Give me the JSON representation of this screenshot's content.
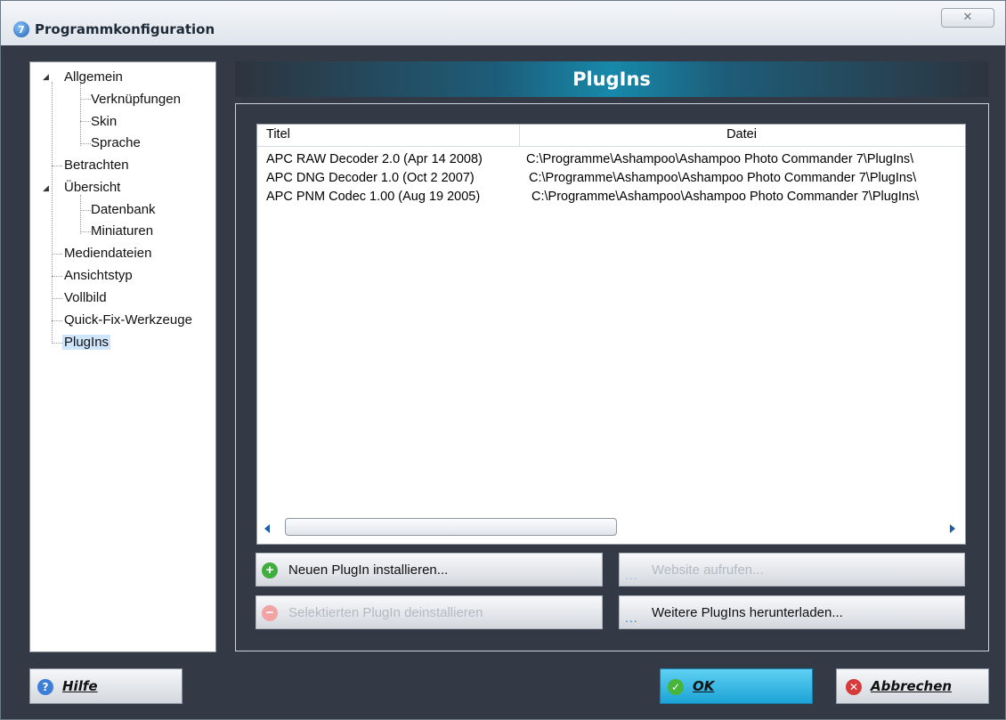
{
  "window": {
    "title": "Programmkonfiguration",
    "app_icon_glyph": "7",
    "close_glyph": "✕"
  },
  "tree": {
    "items": [
      {
        "label": "Allgemein",
        "expanded": true
      },
      {
        "label": "Verknüpfungen"
      },
      {
        "label": "Skin"
      },
      {
        "label": "Sprache"
      },
      {
        "label": "Betrachten"
      },
      {
        "label": "Übersicht",
        "expanded": true
      },
      {
        "label": "Datenbank"
      },
      {
        "label": "Miniaturen"
      },
      {
        "label": "Mediendateien"
      },
      {
        "label": "Ansichtstyp"
      },
      {
        "label": "Vollbild"
      },
      {
        "label": "Quick-Fix-Werkzeuge"
      },
      {
        "label": "PlugIns",
        "selected": true
      }
    ]
  },
  "main": {
    "header": "PlugIns",
    "list": {
      "columns": [
        "Titel",
        "Datei"
      ],
      "rows": [
        [
          "APC RAW Decoder 2.0 (Apr 14 2008)",
          "C:\\Programme\\Ashampoo\\Ashampoo Photo Commander 7\\PlugIns\\"
        ],
        [
          "APC DNG Decoder 1.0 (Oct  2 2007)",
          "C:\\Programme\\Ashampoo\\Ashampoo Photo Commander 7\\PlugIns\\"
        ],
        [
          "APC PNM Codec 1.00 (Aug 19 2005)",
          "C:\\Programme\\Ashampoo\\Ashampoo Photo Commander 7\\PlugIns\\"
        ]
      ]
    },
    "buttons": {
      "install": "Neuen PlugIn installieren...",
      "uninstall": "Selektierten PlugIn deinstallieren",
      "website": "Website aufrufen...",
      "download": "Weitere PlugIns herunterladen...",
      "dots": "..."
    }
  },
  "footer": {
    "help": "Hilfe",
    "ok": "OK",
    "cancel": "Abbrechen"
  },
  "colors": {
    "dialog_bg": "#333a45",
    "header_accent": "#1789aa",
    "selection": "#cfe5fb",
    "add_icon": "#3fae3f",
    "cancel_icon": "#d63a3a",
    "ok_button": "#28b4e0"
  },
  "icons": {
    "app": "app-logo-icon",
    "close": "close-icon",
    "install": "plus-circle-icon",
    "uninstall": "minus-circle-icon",
    "help": "question-circle-icon",
    "ok": "checkmark-circle-icon",
    "cancel": "x-circle-icon"
  }
}
